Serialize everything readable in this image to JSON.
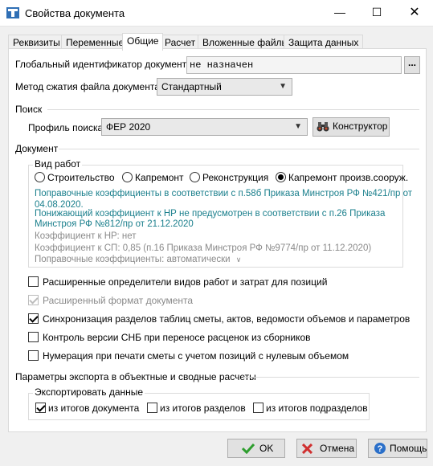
{
  "window": {
    "title": "Свойства документа",
    "minimize": "—",
    "maximize": "☐",
    "close": "✕"
  },
  "tabs": [
    {
      "label": "Реквизиты"
    },
    {
      "label": "Переменные"
    },
    {
      "label": "Общие",
      "active": true
    },
    {
      "label": "Расчет"
    },
    {
      "label": "Вложенные файлы"
    },
    {
      "label": "Защита данных"
    }
  ],
  "general": {
    "guid_label": "Глобальный идентификатор документа:",
    "guid_value": "не назначен",
    "guid_button": "...",
    "compression_label": "Метод сжатия файла документа:",
    "compression_value": "Стандартный"
  },
  "search": {
    "section_title": "Поиск",
    "profile_label": "Профиль поиска:",
    "profile_value": "ФЕР 2020",
    "constructor_button": "Конструктор"
  },
  "document": {
    "section_title": "Документ",
    "work_type": {
      "title": "Вид работ",
      "options": [
        {
          "label": "Строительство",
          "selected": false
        },
        {
          "label": "Капремонт",
          "selected": false
        },
        {
          "label": "Реконструкция",
          "selected": false
        },
        {
          "label": "Капремонт произв.сооруж.",
          "selected": true
        }
      ],
      "info_line1": "Поправочные коэффициенты в соответствии с п.58б Приказа Минстроя РФ №421/пр от",
      "info_line2": "04.08.2020.",
      "info_line3": "Понижающий коэффициент к НР не предусмотрен в соответствии с п.26 Приказа",
      "info_line4": "Минстроя РФ №812/пр от 21.12.2020",
      "coef_hr": "Коэффициент к НР: нет",
      "coef_sp": "Коэффициент к СП: 0,85 (п.16 Приказа Минстроя РФ №9774/пр от 11.12.2020)",
      "corrections": "Поправочные коэффициенты: автоматически"
    },
    "checkboxes": [
      {
        "label": "Расширенные определители видов работ и затрат для  позиций",
        "checked": false,
        "disabled": false
      },
      {
        "label": "Расширенный формат документа",
        "checked": true,
        "disabled": true
      },
      {
        "label": "Синхронизация разделов таблиц сметы, актов, ведомости объемов и параметров",
        "checked": true,
        "disabled": false
      },
      {
        "label": "Контроль версии СНБ при переносе расценок из сборников",
        "checked": false,
        "disabled": false
      },
      {
        "label": "Нумерация при печати сметы с учетом позиций с нулевым объемом",
        "checked": false,
        "disabled": false
      }
    ]
  },
  "export": {
    "section_title": "Параметры экспорта в объектные и сводные расчеты",
    "group_title": "Экспортировать данные",
    "options": [
      {
        "label": "из итогов документа",
        "checked": true
      },
      {
        "label": "из итогов разделов",
        "checked": false
      },
      {
        "label": "из итогов подразделов",
        "checked": false
      }
    ]
  },
  "footer": {
    "ok": "OK",
    "cancel": "Отмена",
    "help": "Помощь"
  },
  "colors": {
    "info_text": "#1a7f8c",
    "ok_check": "#2e9e2e",
    "cancel_x": "#d03030",
    "help_icon": "#2a6fc9"
  }
}
